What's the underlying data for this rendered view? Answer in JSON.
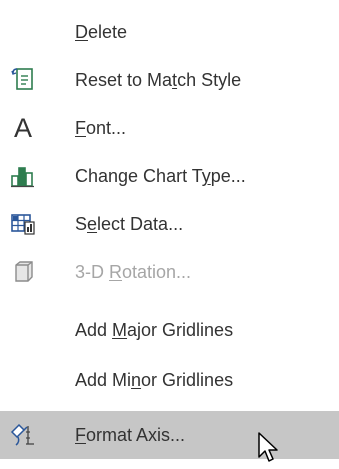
{
  "menu": {
    "items": [
      {
        "label": "Delete",
        "mnemonic_index": 0,
        "icon": "none",
        "enabled": true
      },
      {
        "label": "Reset to Match Style",
        "mnemonic_index": 11,
        "icon": "reset-style-icon",
        "enabled": true
      },
      {
        "label": "Font...",
        "mnemonic_index": 0,
        "icon": "font-icon",
        "icon_glyph": "A",
        "enabled": true
      },
      {
        "label": "Change Chart Type...",
        "mnemonic_index": 14,
        "icon": "chart-type-icon",
        "enabled": true
      },
      {
        "label": "Select Data...",
        "mnemonic_index": 1,
        "icon": "select-data-icon",
        "enabled": true
      },
      {
        "label": "3-D Rotation...",
        "mnemonic_index": 4,
        "icon": "rotation-3d-icon",
        "enabled": false
      },
      {
        "label": "Add Major Gridlines",
        "mnemonic_index": 4,
        "icon": "none",
        "enabled": true
      },
      {
        "label": "Add Minor Gridlines",
        "mnemonic_index": 6,
        "icon": "none",
        "enabled": true
      },
      {
        "label": "Format Axis...",
        "mnemonic_index": 0,
        "icon": "format-axis-icon",
        "enabled": true,
        "highlighted": true
      }
    ]
  },
  "colors": {
    "text": "#333333",
    "disabled_text": "#a6a6a6",
    "hover_background": "#c6c6c6",
    "icon_green": "#2e7d4f",
    "icon_blue": "#2b579a"
  }
}
